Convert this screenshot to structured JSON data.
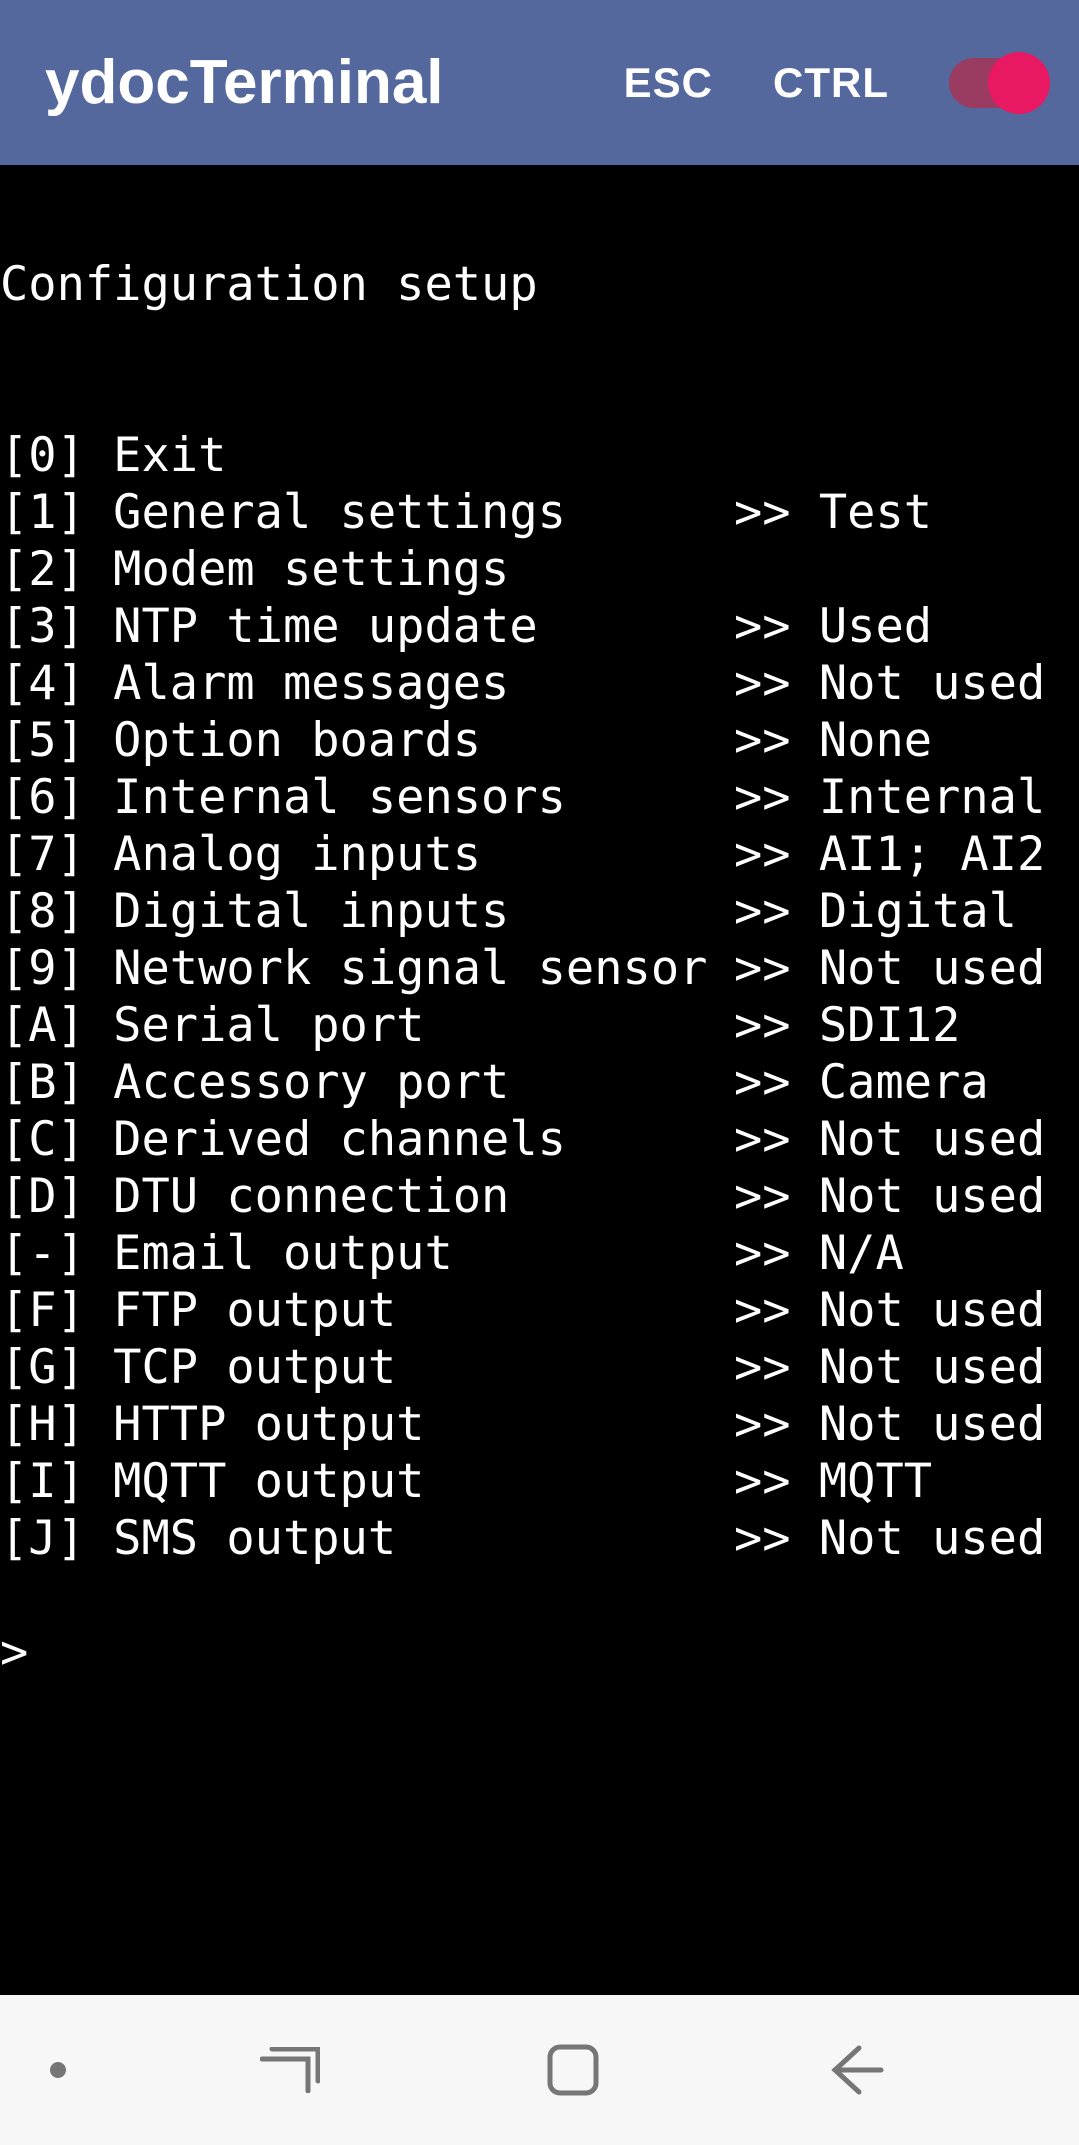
{
  "header": {
    "title": "ydocTerminal",
    "esc_label": "ESC",
    "ctrl_label": "CTRL",
    "toggle_on": true
  },
  "terminal": {
    "title": "Configuration setup",
    "blank": "",
    "items": [
      {
        "key": "0",
        "label": "Exit",
        "status": null
      },
      {
        "key": "1",
        "label": "General settings",
        "status": "Test"
      },
      {
        "key": "2",
        "label": "Modem settings",
        "status": null
      },
      {
        "key": "3",
        "label": "NTP time update",
        "status": "Used"
      },
      {
        "key": "4",
        "label": "Alarm messages",
        "status": "Not used"
      },
      {
        "key": "5",
        "label": "Option boards",
        "status": "None"
      },
      {
        "key": "6",
        "label": "Internal sensors",
        "status": "Internal"
      },
      {
        "key": "7",
        "label": "Analog inputs",
        "status": "AI1; AI2"
      },
      {
        "key": "8",
        "label": "Digital inputs",
        "status": "Digital"
      },
      {
        "key": "9",
        "label": "Network signal sensor",
        "status": "Not used"
      },
      {
        "key": "A",
        "label": "Serial port",
        "status": "SDI12"
      },
      {
        "key": "B",
        "label": "Accessory port",
        "status": "Camera"
      },
      {
        "key": "C",
        "label": "Derived channels",
        "status": "Not used"
      },
      {
        "key": "D",
        "label": "DTU connection",
        "status": "Not used"
      },
      {
        "key": "-",
        "label": "Email output",
        "status": "N/A"
      },
      {
        "key": "F",
        "label": "FTP output",
        "status": "Not used"
      },
      {
        "key": "G",
        "label": "TCP output",
        "status": "Not used"
      },
      {
        "key": "H",
        "label": "HTTP output",
        "status": "Not used"
      },
      {
        "key": "I",
        "label": "MQTT output",
        "status": "MQTT"
      },
      {
        "key": "J",
        "label": "SMS output",
        "status": "Not used"
      }
    ],
    "prompt": ">"
  }
}
